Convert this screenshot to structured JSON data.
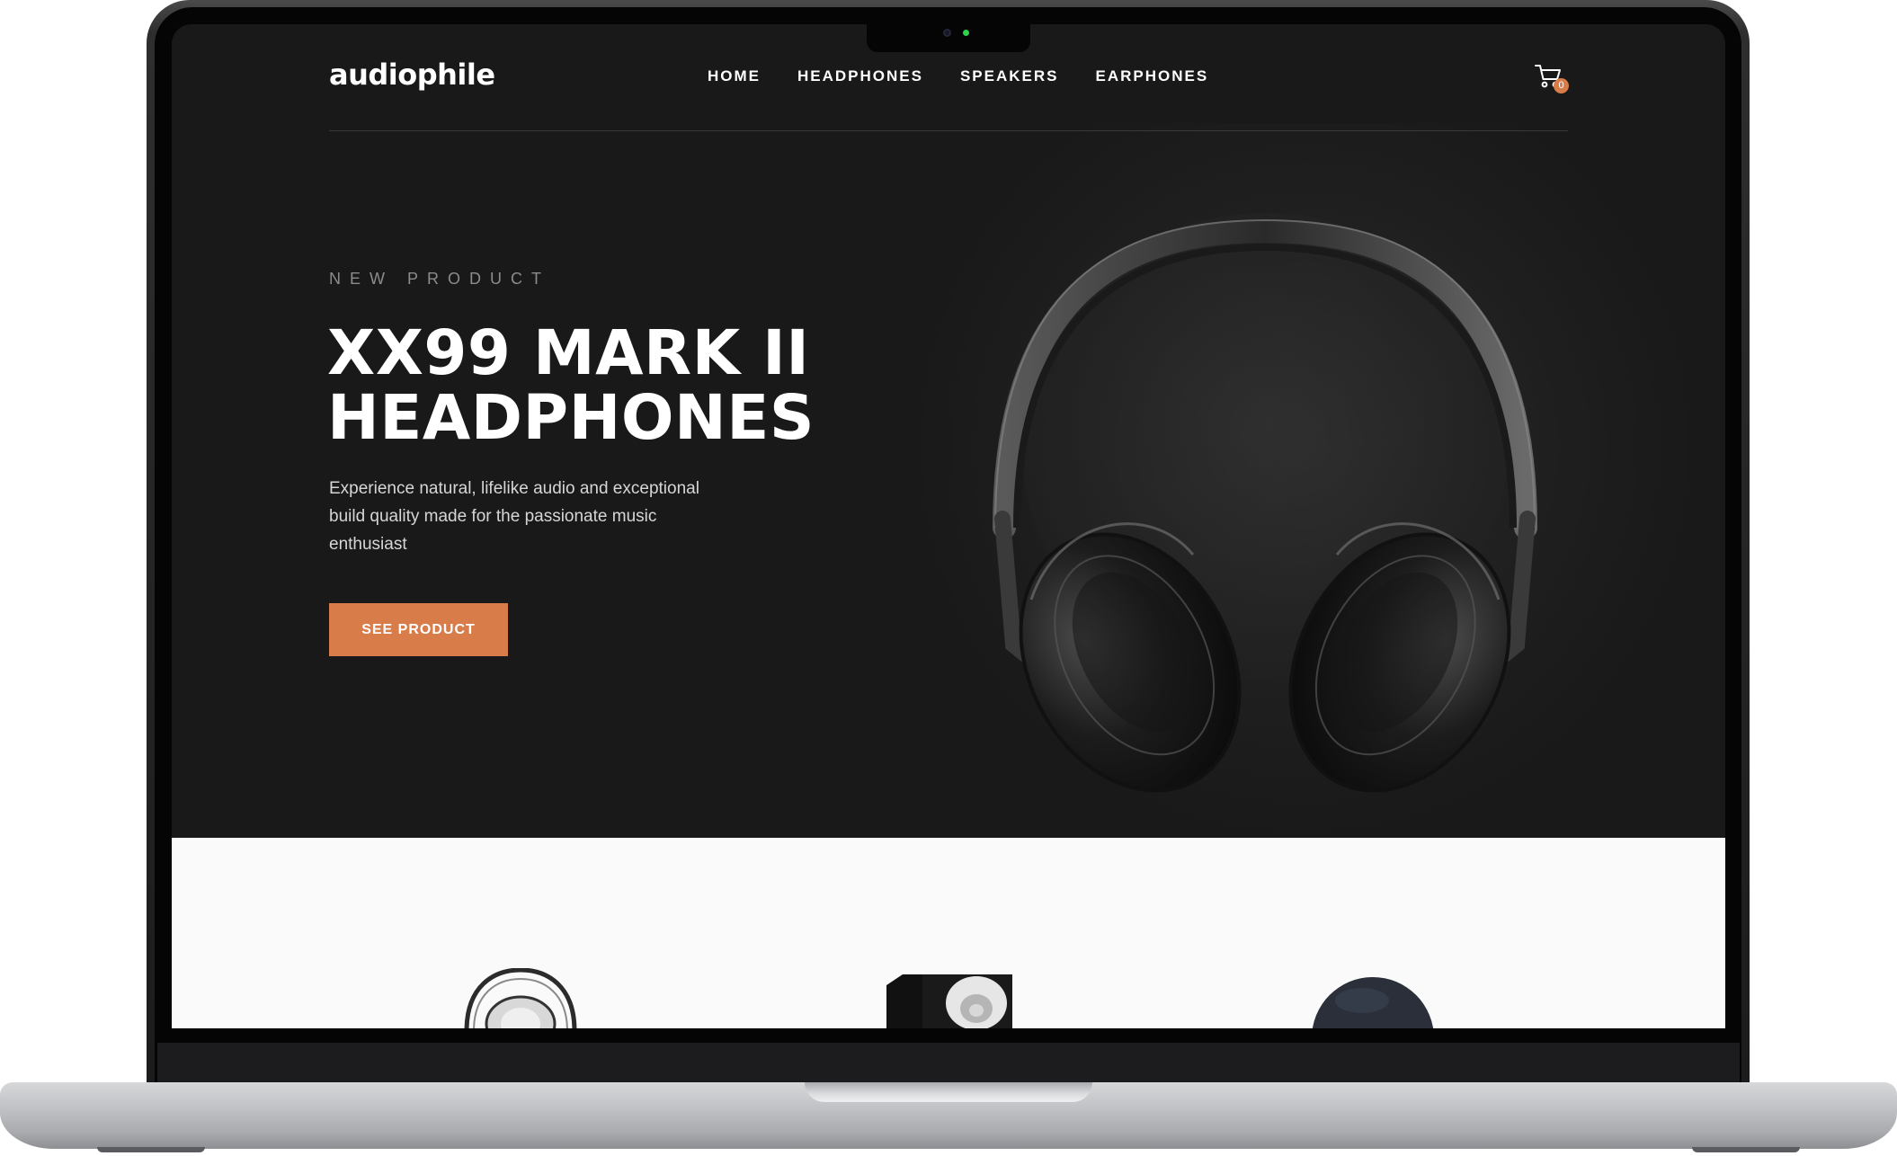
{
  "site": {
    "logo": "audiophile"
  },
  "nav": {
    "items": [
      {
        "label": "HOME"
      },
      {
        "label": "HEADPHONES"
      },
      {
        "label": "SPEAKERS"
      },
      {
        "label": "EARPHONES"
      }
    ]
  },
  "cart": {
    "count": "0",
    "icon": "cart-icon"
  },
  "hero": {
    "overline": "NEW PRODUCT",
    "title_line1": "XX99 MARK II",
    "title_line2": "HEADPHONES",
    "description": "Experience natural, lifelike audio and exceptional build quality made for the passionate music enthusiast",
    "cta_label": "SEE PRODUCT",
    "image": "headphones-image"
  },
  "categories": [
    {
      "icon": "headphones-thumbnail"
    },
    {
      "icon": "speaker-thumbnail"
    },
    {
      "icon": "earphones-thumbnail"
    }
  ],
  "colors": {
    "accent": "#D87D4A",
    "hero_bg": "#191919",
    "light_bg": "#FAFAFA",
    "text_muted": "#8C8C8C"
  }
}
